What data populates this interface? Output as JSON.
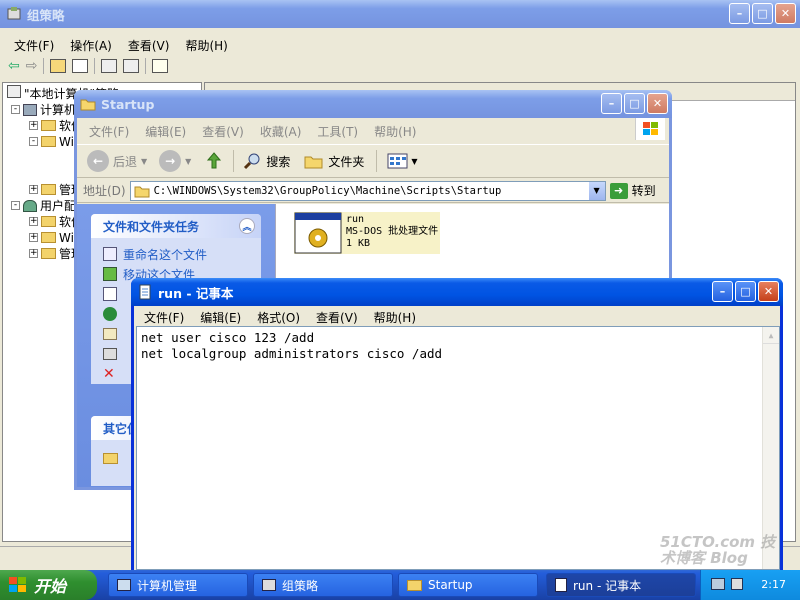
{
  "gpedit": {
    "title": "组策略",
    "menu": [
      "文件(F)",
      "操作(A)",
      "查看(V)",
      "帮助(H)"
    ],
    "tree": [
      "\"本地计算机\"策略",
      "计算机配置",
      "软件设置",
      "Windows 设置",
      "管理模板",
      "用户配置",
      "软件设置",
      "Windows 设置",
      "管理模板"
    ]
  },
  "explorer": {
    "title": "Startup",
    "menu": [
      "文件(F)",
      "编辑(E)",
      "查看(V)",
      "收藏(A)",
      "工具(T)",
      "帮助(H)"
    ],
    "toolbar": {
      "back": "后退",
      "search": "搜索",
      "folders": "文件夹"
    },
    "address_label": "地址(D)",
    "address_value": "C:\\WINDOWS\\System32\\GroupPolicy\\Machine\\Scripts\\Startup",
    "go_label": "转到",
    "task_group_title": "文件和文件夹任务",
    "tasks": [
      "重命名这个文件",
      "移动这个文件"
    ],
    "other_group_title": "其它位置",
    "file": {
      "name": "run",
      "type": "MS-DOS 批处理文件",
      "size": "1 KB"
    }
  },
  "notepad": {
    "title": "run - 记事本",
    "menu": [
      "文件(F)",
      "编辑(E)",
      "格式(O)",
      "查看(V)",
      "帮助(H)"
    ],
    "lines": [
      "net user cisco 123 /add",
      "net localgroup administrators cisco /add"
    ]
  },
  "taskbar": {
    "start": "开始",
    "tasks": [
      "计算机管理",
      "组策略",
      "Startup",
      "run - 记事本"
    ],
    "clock": "2:17"
  },
  "watermark": "51CTO.com 技术博客 Blog"
}
